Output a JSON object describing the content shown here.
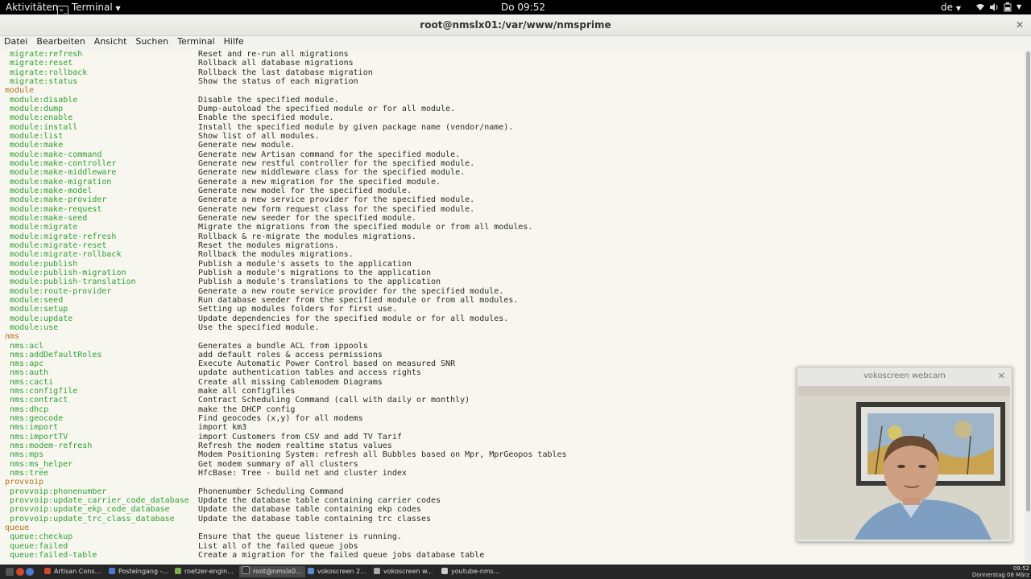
{
  "topbar": {
    "activities": "Aktivitäten",
    "app_menu": "Terminal",
    "clock": "Do 09:52",
    "lang": "de"
  },
  "window": {
    "title": "root@nmslx01:/var/www/nmsprime"
  },
  "menubar": [
    "Datei",
    "Bearbeiten",
    "Ansicht",
    "Suchen",
    "Terminal",
    "Hilfe"
  ],
  "lines": [
    {
      "type": "cmd",
      "c": "migrate:refresh",
      "d": "Reset and re-run all migrations"
    },
    {
      "type": "cmd",
      "c": "migrate:reset",
      "d": "Rollback all database migrations"
    },
    {
      "type": "cmd",
      "c": "migrate:rollback",
      "d": "Rollback the last database migration"
    },
    {
      "type": "cmd",
      "c": "migrate:status",
      "d": "Show the status of each migration"
    },
    {
      "type": "group",
      "c": "module"
    },
    {
      "type": "cmd",
      "c": "module:disable",
      "d": "Disable the specified module."
    },
    {
      "type": "cmd",
      "c": "module:dump",
      "d": "Dump-autoload the specified module or for all module."
    },
    {
      "type": "cmd",
      "c": "module:enable",
      "d": "Enable the specified module."
    },
    {
      "type": "cmd",
      "c": "module:install",
      "d": "Install the specified module by given package name (vendor/name)."
    },
    {
      "type": "cmd",
      "c": "module:list",
      "d": "Show list of all modules."
    },
    {
      "type": "cmd",
      "c": "module:make",
      "d": "Generate new module."
    },
    {
      "type": "cmd",
      "c": "module:make-command",
      "d": "Generate new Artisan command for the specified module."
    },
    {
      "type": "cmd",
      "c": "module:make-controller",
      "d": "Generate new restful controller for the specified module."
    },
    {
      "type": "cmd",
      "c": "module:make-middleware",
      "d": "Generate new middleware class for the specified module."
    },
    {
      "type": "cmd",
      "c": "module:make-migration",
      "d": "Generate a new migration for the specified module."
    },
    {
      "type": "cmd",
      "c": "module:make-model",
      "d": "Generate new model for the specified module."
    },
    {
      "type": "cmd",
      "c": "module:make-provider",
      "d": "Generate a new service provider for the specified module."
    },
    {
      "type": "cmd",
      "c": "module:make-request",
      "d": "Generate new form request class for the specified module."
    },
    {
      "type": "cmd",
      "c": "module:make-seed",
      "d": "Generate new seeder for the specified module."
    },
    {
      "type": "cmd",
      "c": "module:migrate",
      "d": "Migrate the migrations from the specified module or from all modules."
    },
    {
      "type": "cmd",
      "c": "module:migrate-refresh",
      "d": "Rollback & re-migrate the modules migrations."
    },
    {
      "type": "cmd",
      "c": "module:migrate-reset",
      "d": "Reset the modules migrations."
    },
    {
      "type": "cmd",
      "c": "module:migrate-rollback",
      "d": "Rollback the modules migrations."
    },
    {
      "type": "cmd",
      "c": "module:publish",
      "d": "Publish a module's assets to the application"
    },
    {
      "type": "cmd",
      "c": "module:publish-migration",
      "d": "Publish a module's migrations to the application"
    },
    {
      "type": "cmd",
      "c": "module:publish-translation",
      "d": "Publish a module's translations to the application"
    },
    {
      "type": "cmd",
      "c": "module:route-provider",
      "d": "Generate a new route service provider for the specified module."
    },
    {
      "type": "cmd",
      "c": "module:seed",
      "d": "Run database seeder from the specified module or from all modules."
    },
    {
      "type": "cmd",
      "c": "module:setup",
      "d": "Setting up modules folders for first use."
    },
    {
      "type": "cmd",
      "c": "module:update",
      "d": "Update dependencies for the specified module or for all modules."
    },
    {
      "type": "cmd",
      "c": "module:use",
      "d": "Use the specified module."
    },
    {
      "type": "group",
      "c": "nms"
    },
    {
      "type": "cmd",
      "c": "nms:acl",
      "d": "Generates a bundle ACL from ippools"
    },
    {
      "type": "cmd",
      "c": "nms:addDefaultRoles",
      "d": "add default roles & access permissions"
    },
    {
      "type": "cmd",
      "c": "nms:apc",
      "d": "Execute Automatic Power Control based on measured SNR"
    },
    {
      "type": "cmd",
      "c": "nms:auth",
      "d": "update authentication tables and access rights"
    },
    {
      "type": "cmd",
      "c": "nms:cacti",
      "d": "Create all missing Cablemodem Diagrams"
    },
    {
      "type": "cmd",
      "c": "nms:configfile",
      "d": "make all configfiles"
    },
    {
      "type": "cmd",
      "c": "nms:contract",
      "d": "Contract Scheduling Command (call with daily or monthly)"
    },
    {
      "type": "cmd",
      "c": "nms:dhcp",
      "d": "make the DHCP config"
    },
    {
      "type": "cmd",
      "c": "nms:geocode",
      "d": "Find geocodes (x,y) for all modems"
    },
    {
      "type": "cmd",
      "c": "nms:import",
      "d": "import km3"
    },
    {
      "type": "cmd",
      "c": "nms:importTV",
      "d": "import Customers from CSV and add TV Tarif"
    },
    {
      "type": "cmd",
      "c": "nms:modem-refresh",
      "d": "Refresh the modem realtime status values"
    },
    {
      "type": "cmd",
      "c": "nms:mps",
      "d": "Modem Positioning System: refresh all Bubbles based on Mpr, MprGeopos tables"
    },
    {
      "type": "cmd",
      "c": "nms:ms_helper",
      "d": "Get modem summary of all clusters"
    },
    {
      "type": "cmd",
      "c": "nms:tree",
      "d": "HfcBase: Tree - build net and cluster index"
    },
    {
      "type": "group",
      "c": "provvoip"
    },
    {
      "type": "cmd",
      "c": "provvoip:phonenumber",
      "d": "Phonenumber Scheduling Command"
    },
    {
      "type": "cmd",
      "c": "provvoip:update_carrier_code_database",
      "d": "Update the database table containing carrier codes"
    },
    {
      "type": "cmd",
      "c": "provvoip:update_ekp_code_database",
      "d": "Update the database table containing ekp codes"
    },
    {
      "type": "cmd",
      "c": "provvoip:update_trc_class_database",
      "d": "Update the database table containing trc classes"
    },
    {
      "type": "group",
      "c": "queue"
    },
    {
      "type": "cmd",
      "c": "queue:checkup",
      "d": "Ensure that the queue listener is running."
    },
    {
      "type": "cmd",
      "c": "queue:failed",
      "d": "List all of the failed queue jobs"
    },
    {
      "type": "cmd",
      "c": "queue:failed-table",
      "d": "Create a migration for the failed queue jobs database table"
    }
  ],
  "webcam": {
    "title": "vokoscreen webcam"
  },
  "taskbar": {
    "tasks": [
      {
        "label": "Artisan Cons...",
        "icon_color": "#d04a2a"
      },
      {
        "label": "Posteingang -...",
        "icon_color": "#4a7ad0"
      },
      {
        "label": "roetzer-engin...",
        "icon_color": "#7ab050"
      },
      {
        "label": "root@nmslx0...",
        "icon_color": "#333333",
        "active": true
      },
      {
        "label": "vokoscreen 2...",
        "icon_color": "#5a8ad0"
      },
      {
        "label": "vokoscreen w...",
        "icon_color": "#aaaaaa"
      },
      {
        "label": "youtube-nms...",
        "icon_color": "#cccccc"
      }
    ],
    "time": "09:52",
    "date": "Donnerstag 08 März"
  }
}
